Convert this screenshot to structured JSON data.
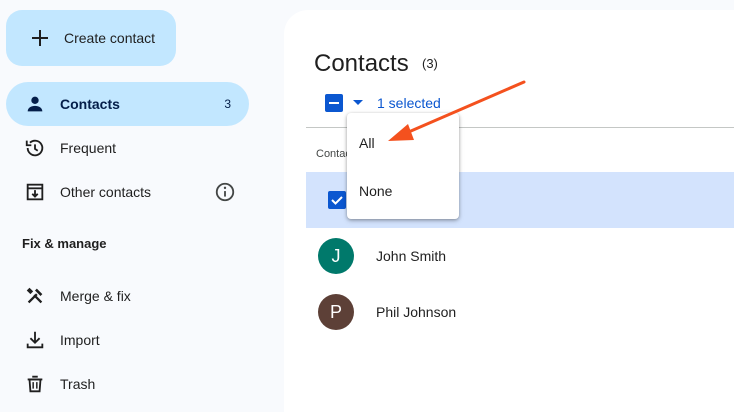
{
  "sidebar": {
    "create_label": "Create contact",
    "items": [
      {
        "label": "Contacts",
        "count": "3",
        "icon": "person-icon"
      },
      {
        "label": "Frequent",
        "icon": "history-icon"
      },
      {
        "label": "Other contacts",
        "icon": "download-box-icon"
      }
    ],
    "section_title": "Fix & manage",
    "manage_items": [
      {
        "label": "Merge & fix",
        "icon": "tools-icon"
      },
      {
        "label": "Import",
        "icon": "import-icon"
      },
      {
        "label": "Trash",
        "icon": "trash-icon"
      }
    ]
  },
  "main": {
    "title": "Contacts",
    "title_count": "(3)",
    "selection_label": "1 selected",
    "column_header": "Contacts",
    "rows": [
      {
        "name": "",
        "avatar_letter": "",
        "selected": true
      },
      {
        "name": "John Smith",
        "avatar_letter": "J",
        "avatar_color": "#00796b"
      },
      {
        "name": "Phil Johnson",
        "avatar_letter": "P",
        "avatar_color": "#5d4037"
      }
    ]
  },
  "dropdown": {
    "items": [
      {
        "label": "All"
      },
      {
        "label": "None"
      }
    ]
  },
  "colors": {
    "accent": "#0b57d0",
    "active_nav": "#c2e7ff",
    "selected_row": "#d3e3fd",
    "annotation_arrow": "#f4511e"
  }
}
